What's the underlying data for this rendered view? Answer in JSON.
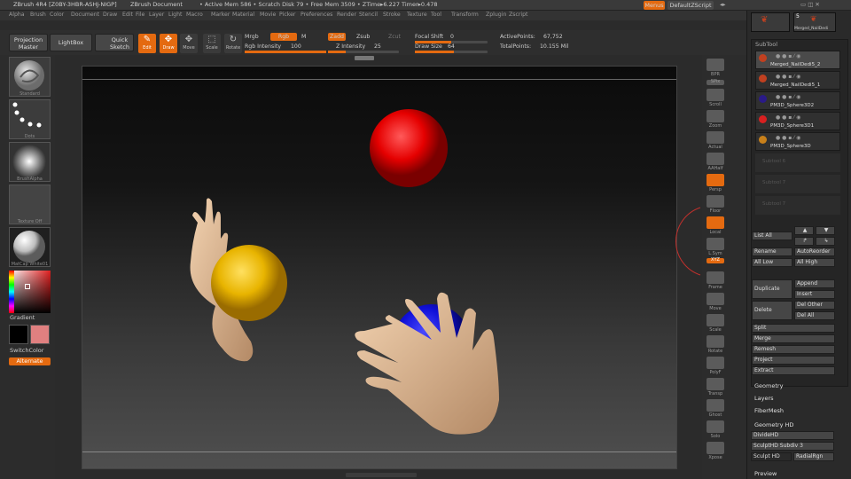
{
  "titlebar": {
    "app": "ZBrush 4R4 [Z0BY-3HBR-ASHJ-NIGP]",
    "doc": "ZBrush Document",
    "stats": "• Active Mem 586 • Scratch Disk 79 • Free Mem 3509 • ZTime▸6.227 Timer▸0.478",
    "menus_btn": "Menus",
    "script_btn": "DefaultZScript"
  },
  "menu_items": [
    "Alpha",
    "Brush",
    "Color",
    "Document",
    "Draw",
    "Edit",
    "File",
    "Layer",
    "Light",
    "Macro",
    "Marker",
    "Material",
    "Movie",
    "Picker",
    "Preferences",
    "Render",
    "Stencil",
    "Stroke",
    "Texture",
    "Tool",
    "Transform",
    "Zplugin",
    "Zscript"
  ],
  "toolbar": {
    "projection_master": "Projection Master",
    "lightbox": "LightBox",
    "quick_sketch": "Quick Sketch",
    "tools": [
      {
        "label": "Edit",
        "glyph": "✎",
        "on": true
      },
      {
        "label": "Draw",
        "glyph": "✥",
        "on": true
      },
      {
        "label": "Move",
        "glyph": "✥",
        "on": false
      },
      {
        "label": "Scale",
        "glyph": "⬚",
        "on": false
      },
      {
        "label": "Rotate",
        "glyph": "↻",
        "on": false
      }
    ],
    "mrgb": "Mrgb",
    "rgb": "Rgb",
    "m": "M",
    "rgb_intensity_label": "Rgb Intensity",
    "rgb_intensity": "100",
    "zadd": "Zadd",
    "zsub": "Zsub",
    "zcut": "Zcut",
    "z_intensity_label": "Z Intensity",
    "z_intensity": "25",
    "focal_shift_label": "Focal Shift",
    "focal_shift": "0",
    "draw_size_label": "Draw Size",
    "draw_size": "64",
    "active_points_label": "ActivePoints:",
    "active_points": "67,752",
    "total_points_label": "TotalPoints:",
    "total_points": "10.155 Mil"
  },
  "left_shelf": {
    "brush": "Standard",
    "stroke": "Dots",
    "alpha": "BrushAlpha",
    "texture": "Texture Off",
    "material": "MatCap White01",
    "gradient": "Gradient",
    "switch_color": "SwitchColor",
    "alternate": "Alternate"
  },
  "right_col": [
    {
      "label": "BPR",
      "on": false
    },
    {
      "label": "SPix",
      "on": false
    },
    {
      "label": "Scroll",
      "on": false
    },
    {
      "label": "Zoom",
      "on": false
    },
    {
      "label": "Actual",
      "on": false
    },
    {
      "label": "AAHalf",
      "on": false
    },
    {
      "label": "Persp",
      "on": true
    },
    {
      "label": "Floor",
      "on": false
    },
    {
      "label": "Local",
      "on": true
    },
    {
      "label": "L.Sym",
      "on": false
    },
    {
      "label": "XYZ",
      "on": true
    },
    {
      "label": "Frame",
      "on": false
    },
    {
      "label": "Move",
      "on": false
    },
    {
      "label": "Scale",
      "on": false
    },
    {
      "label": "Rotate",
      "on": false
    },
    {
      "label": "PolyF",
      "on": false
    },
    {
      "label": "Transp",
      "on": false
    },
    {
      "label": "Ghost",
      "on": false
    },
    {
      "label": "Solo",
      "on": false
    },
    {
      "label": "Xpose",
      "on": false
    }
  ],
  "tray": {
    "top_thumb_label": "Merged_NailDedi",
    "top_thumb_count": "5",
    "subtool_header": "SubTool",
    "subtools": [
      {
        "name": "Merged_NailDedi5_2",
        "color": "#c04020"
      },
      {
        "name": "Merged_NailDedi5_1",
        "color": "#c04020"
      },
      {
        "name": "PM3D_Sphere3D2",
        "color": "#2a1a88"
      },
      {
        "name": "PM3D_Sphere3D1",
        "color": "#d82020"
      },
      {
        "name": "PM3D_Sphere3D",
        "color": "#c8801a"
      }
    ],
    "empty_slots": [
      "Subtool 6",
      "Subtool 7",
      "Subtool 7"
    ],
    "list_all": "List All",
    "rename": "Rename",
    "auto_reorder": "AutoReorder",
    "all_low": "All Low",
    "all_high": "All High",
    "duplicate": "Duplicate",
    "append": "Append",
    "insert": "Insert",
    "delete": "Delete",
    "del_other": "Del Other",
    "del_all": "Del All",
    "split": "Split",
    "merge": "Merge",
    "remesh": "Remesh",
    "project": "Project",
    "extract": "Extract",
    "geometry": "Geometry",
    "layers": "Layers",
    "fibermesh": "FiberMesh",
    "geometry_hd": "Geometry HD",
    "divide_hd": "DivideHD",
    "sculpthd_subdiv": "SculptHD Subdiv 3",
    "sculpt_hd": "Sculpt HD",
    "radial_rgn": "RadialRgn",
    "preview": "Preview"
  }
}
